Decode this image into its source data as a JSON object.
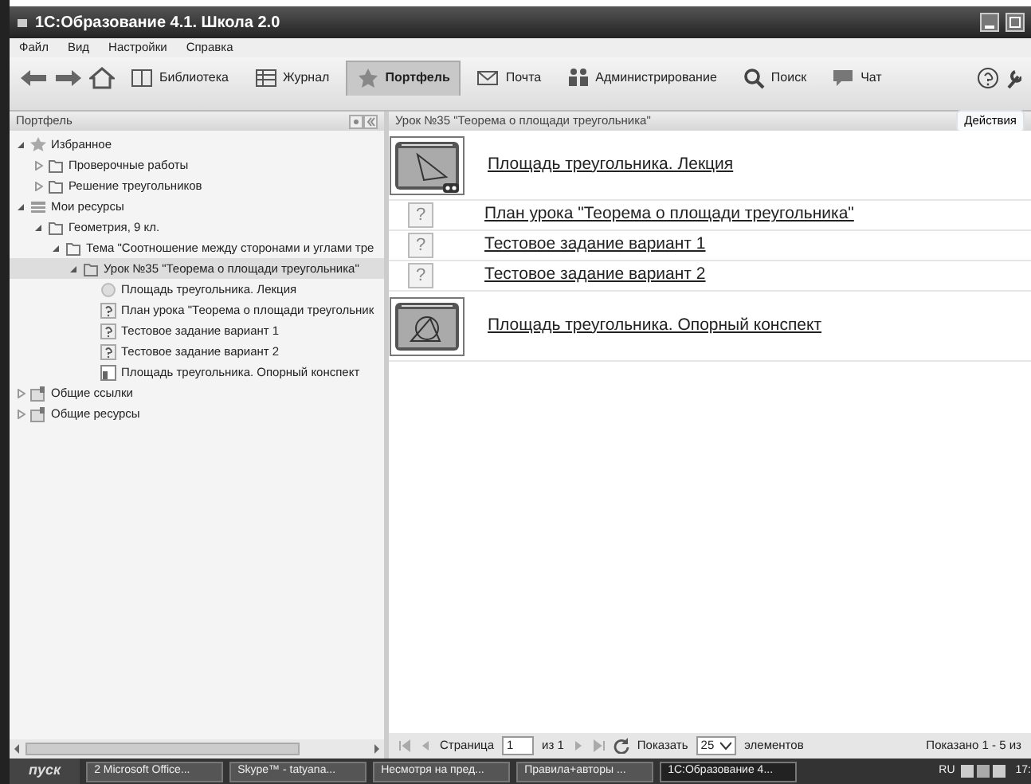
{
  "window": {
    "title": "1С:Образование 4.1. Школа 2.0"
  },
  "menu": [
    "Файл",
    "Вид",
    "Настройки",
    "Справка"
  ],
  "toolbar": [
    {
      "label": "Библиотека",
      "kind": "book",
      "selected": false
    },
    {
      "label": "Журнал",
      "kind": "table",
      "selected": false
    },
    {
      "label": "Портфель",
      "kind": "star",
      "selected": true
    },
    {
      "label": "Почта",
      "kind": "mail",
      "selected": false
    },
    {
      "label": "Администрирование",
      "kind": "admin",
      "selected": false
    },
    {
      "label": "Поиск",
      "kind": "search",
      "selected": false
    },
    {
      "label": "Чат",
      "kind": "chat",
      "selected": false
    }
  ],
  "sidebar": {
    "title": "Портфель",
    "tree": [
      {
        "label": "Избранное",
        "kind": "star",
        "expanded": true,
        "selected": false,
        "children": [
          {
            "label": "Проверочные работы",
            "kind": "folder",
            "expanded": false,
            "selected": false
          },
          {
            "label": "Решение треугольников",
            "kind": "folder",
            "expanded": false,
            "selected": false
          }
        ]
      },
      {
        "label": "Мои ресурсы",
        "kind": "grid",
        "expanded": true,
        "selected": false,
        "children": [
          {
            "label": "Геометрия, 9 кл.",
            "kind": "folder",
            "expanded": true,
            "selected": false,
            "children": [
              {
                "label": "Тема \"Соотношение между сторонами и углами тре",
                "kind": "folder",
                "expanded": true,
                "selected": false,
                "children": [
                  {
                    "label": "Урок №35 \"Теорема о площади треугольника\"",
                    "kind": "folder",
                    "expanded": true,
                    "selected": true,
                    "children": [
                      {
                        "label": "Площадь треугольника. Лекция",
                        "kind": "disc",
                        "selected": false
                      },
                      {
                        "label": "План урока \"Теорема о площади треугольник",
                        "kind": "question",
                        "selected": false
                      },
                      {
                        "label": "Тестовое задание вариант 1",
                        "kind": "question",
                        "selected": false
                      },
                      {
                        "label": "Тестовое задание вариант 2",
                        "kind": "question",
                        "selected": false
                      },
                      {
                        "label": "Площадь треугольника. Опорный конспект",
                        "kind": "doc",
                        "selected": false
                      }
                    ]
                  }
                ]
              }
            ]
          }
        ]
      },
      {
        "label": "Общие ссылки",
        "kind": "shared",
        "expanded": false,
        "selected": false
      },
      {
        "label": "Общие ресурсы",
        "kind": "shared",
        "expanded": false,
        "selected": false
      }
    ]
  },
  "content": {
    "title": "Урок №35 \"Теорема о площади треугольника\"",
    "actions": "Действия",
    "items": [
      {
        "kind": "lecture",
        "label": "Площадь треугольника. Лекция"
      },
      {
        "kind": "question",
        "icon_text": "?",
        "label": "План урока \"Теорема о площади треугольника\""
      },
      {
        "kind": "question",
        "icon_text": "?",
        "label": "Тестовое задание вариант 1"
      },
      {
        "kind": "question",
        "icon_text": "?",
        "label": "Тестовое задание вариант 2"
      },
      {
        "kind": "summary",
        "label": "Площадь треугольника. Опорный конспект"
      }
    ]
  },
  "pager": {
    "page_label": "Страница",
    "page": "1",
    "of": "из 1",
    "show_label": "Показать",
    "per_page": "25",
    "items_label": "элементов",
    "summary": "Показано 1 - 5 из"
  },
  "taskbar": {
    "start": "пуск",
    "tasks": [
      {
        "label": "2 Microsoft Office...",
        "selected": false
      },
      {
        "label": "Skype™ - tatyana...",
        "selected": false
      },
      {
        "label": "Несмотря на пред...",
        "selected": false
      },
      {
        "label": "Правила+авторы ...",
        "selected": false
      },
      {
        "label": "1С:Образование 4...",
        "selected": true
      }
    ],
    "lang": "RU",
    "clock": "17:"
  }
}
